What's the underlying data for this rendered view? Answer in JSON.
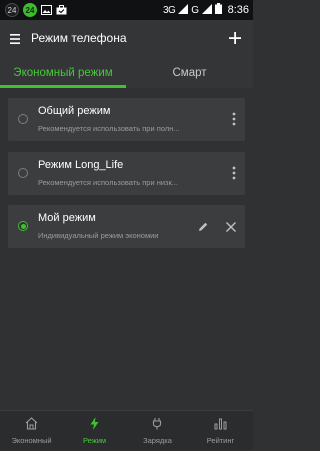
{
  "status_bar": {
    "notification_badge": "24",
    "notification_badge_2": "24",
    "network_label": "3G",
    "network_label_2": "G",
    "time": "8:36"
  },
  "app_bar": {
    "title": "Режим телефона"
  },
  "tabs": [
    {
      "label": "Экономный режим",
      "active": true
    },
    {
      "label": "Смарт",
      "active": false
    }
  ],
  "modes": [
    {
      "title": "Общий режим",
      "subtitle": "Рекомендуется использовать при полн...",
      "selected": false
    },
    {
      "title": "Режим Long_Life",
      "subtitle": "Рекомендуется использовать при низк...",
      "selected": false
    },
    {
      "title": "Мой режим",
      "subtitle": "Индивидуальный режим экономии",
      "selected": true
    }
  ],
  "bottom_nav": [
    {
      "label": "Экономный",
      "icon": "house-icon",
      "active": false
    },
    {
      "label": "Режим",
      "icon": "bolt-icon",
      "active": true
    },
    {
      "label": "Зарядка",
      "icon": "plug-icon",
      "active": false
    },
    {
      "label": "Рейтинг",
      "icon": "bar-chart-icon",
      "active": false
    }
  ],
  "colors": {
    "accent": "#3ec32c",
    "background": "#2f3133",
    "card": "#3b3d3f",
    "status_bar": "#101113"
  }
}
